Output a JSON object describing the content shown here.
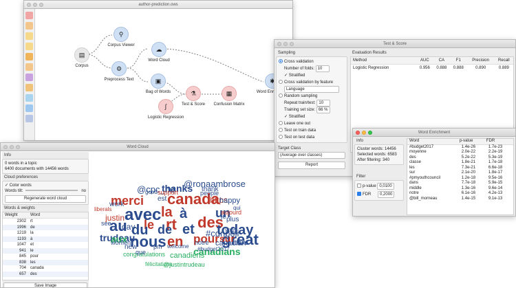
{
  "canvas": {
    "title": "author-prediction.ows"
  },
  "toolbox": {
    "icons": [
      "data-icon",
      "table-icon",
      "scatter-icon",
      "tree-icon",
      "distribution-icon",
      "box-icon",
      "line-icon",
      "network-icon",
      "hierarchy-icon",
      "model-icon",
      "rank-icon"
    ]
  },
  "nodes": {
    "corpus": "Corpus",
    "corpus_viewer": "Corpus Viewer",
    "preprocess_text": "Preprocess Text",
    "word_cloud": "Word Cloud",
    "bag_of_words": "Bag of Words",
    "logistic_regression": "Logistic Regression",
    "test_score": "Test & Score",
    "confusion_matrix": "Confusion Matrix",
    "word_enrichment": "Word Enrichment"
  },
  "test_score": {
    "title": "Test & Score",
    "sampling_label": "Sampling",
    "cross_validation": "Cross validation",
    "folds_label": "Number of folds:",
    "folds_value": "10",
    "stratified": "Stratified",
    "cv_by_feature": "Cross validation by feature",
    "feature_value": "Language",
    "random_sampling": "Random sampling",
    "repeat_label": "Repeat train/test:",
    "repeat_value": "10",
    "train_size_label": "Training set size:",
    "train_size_value": "66 %",
    "stratified2": "Stratified",
    "leave_one_out": "Leave one out",
    "test_on_train": "Test on train data",
    "test_on_test": "Test on test data",
    "target_class_label": "Target Class",
    "target_class_value": "(Average over classes)",
    "report": "Report",
    "eval_results": "Evaluation Results",
    "columns": [
      "Method",
      "AUC",
      "CA",
      "F1",
      "Precision",
      "Recall"
    ],
    "rows": [
      [
        "Logistic Regression",
        "0.956",
        "0.888",
        "0.888",
        "0.890",
        "0.889"
      ]
    ]
  },
  "word_cloud": {
    "title": "Word Cloud",
    "info_label": "Info",
    "info_topic": "0 words in a topic",
    "info_docs": "6400 documents with 14456 words",
    "prefs_label": "Cloud preferences",
    "color_words": "Color words",
    "words_tilt": "Words tilt:",
    "tilt_value": "no",
    "regenerate": "Regenerate word cloud",
    "weights_label": "Words & weights",
    "columns": [
      "Weight",
      "Word"
    ],
    "rows": [
      [
        "2302",
        "rt"
      ],
      [
        "1996",
        "de"
      ],
      [
        "1219",
        "la"
      ],
      [
        "1193",
        "à"
      ],
      [
        "1047",
        "et"
      ],
      [
        "941",
        "le"
      ],
      [
        "845",
        "pour"
      ],
      [
        "838",
        "les"
      ],
      [
        "704",
        "canada"
      ],
      [
        "657",
        "des"
      ]
    ],
    "save_image": "Save Image"
  },
  "word_enrichment": {
    "title": "Word Enrichment",
    "info_label": "Info",
    "cluster_words": "Cluster words: 14456",
    "selected_words": "Selected words: 6583",
    "after_filtering": "After filtering: 340",
    "filter_label": "Filter",
    "pvalue_label": "p-value",
    "pvalue_value": "0,0100",
    "fdr_label": "FDR",
    "fdr_value": "0,2000",
    "columns": [
      "Word",
      "p-value",
      "FDR"
    ],
    "rows": [
      [
        "#budget2017",
        "1.4e-26",
        "1.7e-23"
      ],
      [
        "moyenne",
        "2.0e-22",
        "2.2e-19"
      ],
      [
        "des",
        "5.2e-22",
        "5.3e-19"
      ],
      [
        "classe",
        "1.8e-21",
        "1.7e-18"
      ],
      [
        "les",
        "7.3e-21",
        "6.6e-18"
      ],
      [
        "sur",
        "2.1e-20",
        "1.8e-17"
      ],
      [
        "#pmyouthcouncil",
        "1.2e-18",
        "9.5e-16"
      ],
      [
        "dans",
        "7.7e-18",
        "5.9e-15"
      ],
      [
        "middle",
        "1.3e-16",
        "9.6e-14"
      ],
      [
        "notre",
        "6.1e-16",
        "4.2e-13"
      ],
      [
        "@bill_morneau",
        "1.4e-15",
        "9.1e-13"
      ]
    ]
  },
  "cloud_words": [
    {
      "t": "nous",
      "c": "#2a4b8d"
    },
    {
      "t": "en",
      "c": "#c0392b"
    },
    {
      "t": "pour",
      "c": "#c0392b"
    },
    {
      "t": "great",
      "c": "#2a4b8d"
    },
    {
      "t": "avec",
      "c": "#2a4b8d"
    },
    {
      "t": "la",
      "c": "#c0392b"
    },
    {
      "t": "au",
      "c": "#2a4b8d"
    },
    {
      "t": "le",
      "c": "#c0392b"
    },
    {
      "t": "rt",
      "c": "#c0392b"
    },
    {
      "t": "à",
      "c": "#2a4b8d"
    },
    {
      "t": "des",
      "c": "#c0392b"
    },
    {
      "t": "du",
      "c": "#2a4b8d"
    },
    {
      "t": "de",
      "c": "#2a4b8d"
    },
    {
      "t": "et",
      "c": "#2a4b8d"
    },
    {
      "t": "today",
      "c": "#2a4b8d"
    },
    {
      "t": "canada",
      "c": "#c0392b"
    },
    {
      "t": "un",
      "c": "#2a4b8d"
    },
    {
      "t": "thanks",
      "c": "#2a4b8d"
    },
    {
      "t": "merci",
      "c": "#c0392b"
    },
    {
      "t": "canadians",
      "c": "#27ae60"
    },
    {
      "t": "trudeau",
      "c": "#2a4b8d"
    },
    {
      "t": "day",
      "c": "#2a4b8d"
    },
    {
      "t": "sur",
      "c": "#c0392b"
    },
    {
      "t": "aux",
      "c": "#27ae60"
    },
    {
      "t": "#cdnpoli",
      "c": "#2a4b8d"
    },
    {
      "t": "thank",
      "c": "#2a4b8d"
    },
    {
      "t": "work",
      "c": "#2a4b8d"
    },
    {
      "t": "est",
      "c": "#2a4b8d"
    },
    {
      "t": "https",
      "c": "#c0392b"
    },
    {
      "t": "@ronaambrose",
      "c": "#2a4b8d"
    },
    {
      "t": "@cpc_hq",
      "c": "#2a4b8d"
    },
    {
      "t": "justin",
      "c": "#c0392b"
    },
    {
      "t": "je",
      "c": "#2a4b8d"
    },
    {
      "t": "plus",
      "c": "#2a4b8d"
    },
    {
      "t": "congratulations",
      "c": "#27ae60"
    },
    {
      "t": "canadiens",
      "c": "#27ae60"
    },
    {
      "t": "dans",
      "c": "#2a4b8d"
    },
    {
      "t": "new",
      "c": "#2a4b8d"
    },
    {
      "t": "que",
      "c": "#2a4b8d"
    },
    {
      "t": "see",
      "c": "#2a4b8d"
    },
    {
      "t": "vous",
      "c": "#2a4b8d"
    },
    {
      "t": "qui",
      "c": "#2a4b8d"
    },
    {
      "t": "canadian",
      "c": "#2a4b8d"
    },
    {
      "t": "happy",
      "c": "#2a4b8d"
    },
    {
      "t": "liberals",
      "c": "#c0392b"
    },
    {
      "t": "good",
      "c": "#2a4b8d"
    },
    {
      "t": "support",
      "c": "#c0392b"
    },
    {
      "t": "#budget2017",
      "c": "#2a4b8d"
    },
    {
      "t": "women",
      "c": "#2a4b8d"
    },
    {
      "t": "welcome",
      "c": "#2a4b8d"
    },
    {
      "t": "pm",
      "c": "#2a4b8d"
    },
    {
      "t": "notre",
      "c": "#2a4b8d"
    },
    {
      "t": "@justintrudeau",
      "c": "#27ae60"
    },
    {
      "t": "félicitations",
      "c": "#27ae60"
    },
    {
      "t": "aujourd",
      "c": "#c0392b"
    },
    {
      "t": "people",
      "c": "#2a4b8d"
    }
  ]
}
